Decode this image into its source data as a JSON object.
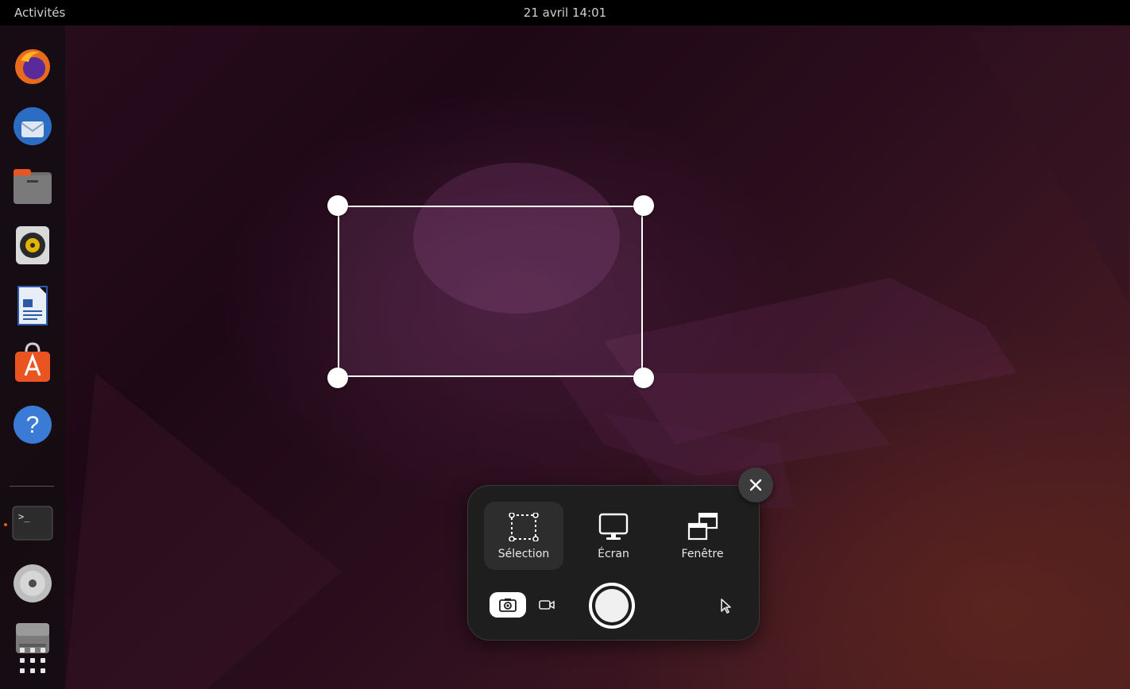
{
  "topbar": {
    "activities_label": "Activités",
    "clock": "21 avril  14:01"
  },
  "dock": {
    "items": [
      {
        "name": "firefox",
        "icon": "firefox-icon"
      },
      {
        "name": "thunderbird",
        "icon": "thunderbird-icon"
      },
      {
        "name": "files",
        "icon": "folder-icon"
      },
      {
        "name": "rhythmbox",
        "icon": "speaker-icon"
      },
      {
        "name": "libreoffice-writer",
        "icon": "document-icon"
      },
      {
        "name": "software",
        "icon": "app-store-icon"
      },
      {
        "name": "help",
        "icon": "help-icon"
      },
      {
        "name": "terminal",
        "icon": "terminal-icon",
        "running": true
      },
      {
        "name": "disc",
        "icon": "disc-icon"
      },
      {
        "name": "drive",
        "icon": "drive-icon"
      },
      {
        "name": "show-apps",
        "icon": "app-grid-icon"
      }
    ],
    "terminal_prompt": ">_"
  },
  "screenshot_ui": {
    "modes": [
      {
        "label": "Sélection",
        "icon": "selection-icon",
        "active": true
      },
      {
        "label": "Écran",
        "icon": "monitor-icon",
        "active": false
      },
      {
        "label": "Fenêtre",
        "icon": "window-icon",
        "active": false
      }
    ],
    "capture_type": {
      "screenshot_icon": "camera-icon",
      "screencast_icon": "video-camera-icon",
      "selected": "screenshot"
    },
    "shutter_icon": "shutter-button",
    "pointer_icon": "pointer-icon",
    "close_icon": "close-icon"
  },
  "colors": {
    "accent_running": "#e9541e",
    "panel_bg": "#1e1e1e"
  }
}
